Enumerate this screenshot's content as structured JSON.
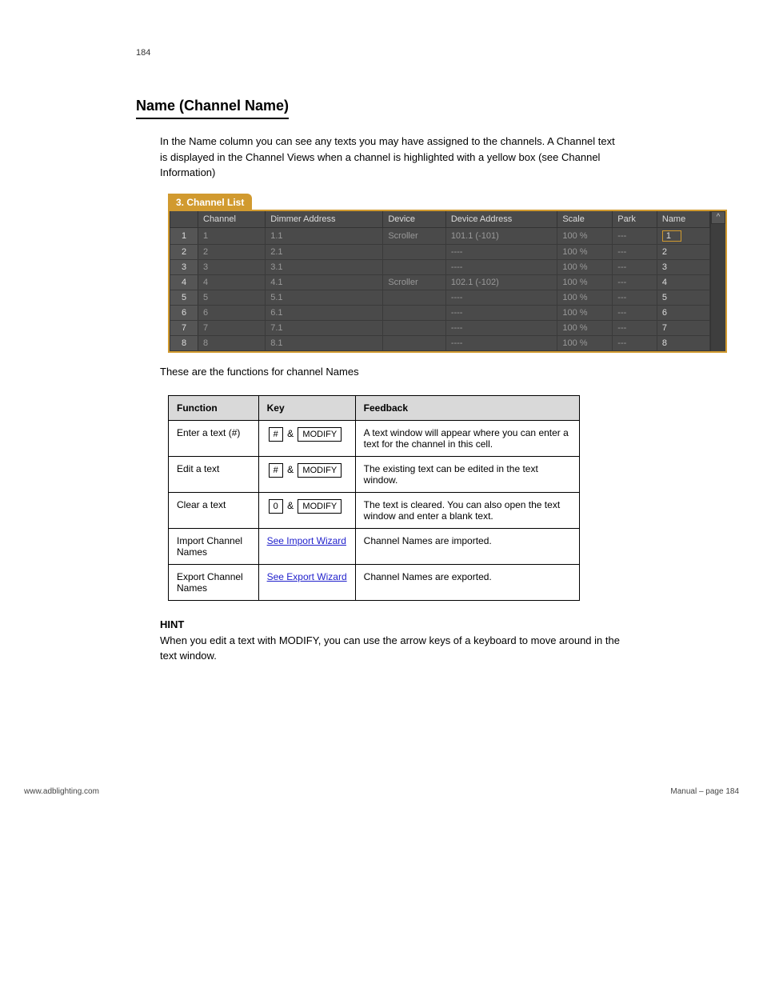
{
  "page_label": "184",
  "section_heading": "Name (Channel Name)",
  "intro_paragraphs": [
    "In the Name column you can see any texts you may have assigned to the channels.  A Channel text is displayed in the Channel Views when a channel is highlighted with a yellow box (see Channel Information)"
  ],
  "screenshot": {
    "tab_title": "3. Channel List",
    "headers": [
      "",
      "Channel",
      "Dimmer Address",
      "Device",
      "Device Address",
      "Scale",
      "Park",
      "Name"
    ],
    "rows": [
      {
        "n": "1",
        "ch": "1",
        "dim": "1.1",
        "dev": "Scroller",
        "da": "101.1 (-101)",
        "sc": "100 %",
        "pk": "---",
        "nm": "1",
        "sel": true
      },
      {
        "n": "2",
        "ch": "2",
        "dim": "2.1",
        "dev": "",
        "da": "----",
        "sc": "100 %",
        "pk": "---",
        "nm": "2",
        "sel": false
      },
      {
        "n": "3",
        "ch": "3",
        "dim": "3.1",
        "dev": "",
        "da": "----",
        "sc": "100 %",
        "pk": "---",
        "nm": "3",
        "sel": false
      },
      {
        "n": "4",
        "ch": "4",
        "dim": "4.1",
        "dev": "Scroller",
        "da": "102.1 (-102)",
        "sc": "100 %",
        "pk": "---",
        "nm": "4",
        "sel": false
      },
      {
        "n": "5",
        "ch": "5",
        "dim": "5.1",
        "dev": "",
        "da": "----",
        "sc": "100 %",
        "pk": "---",
        "nm": "5",
        "sel": false
      },
      {
        "n": "6",
        "ch": "6",
        "dim": "6.1",
        "dev": "",
        "da": "----",
        "sc": "100 %",
        "pk": "---",
        "nm": "6",
        "sel": false
      },
      {
        "n": "7",
        "ch": "7",
        "dim": "7.1",
        "dev": "",
        "da": "----",
        "sc": "100 %",
        "pk": "---",
        "nm": "7",
        "sel": false
      },
      {
        "n": "8",
        "ch": "8",
        "dim": "8.1",
        "dev": "",
        "da": "----",
        "sc": "100 %",
        "pk": "---",
        "nm": "8",
        "sel": false
      }
    ],
    "scroll_up": "^"
  },
  "functions_intro": "These are the functions for channel Names",
  "func_table": {
    "headers": [
      "Function",
      "Key",
      "Feedback"
    ],
    "rows": [
      {
        "func": "Enter a text (#)",
        "keys": [
          "#",
          "MODIFY"
        ],
        "fb": "A text window will appear where you can enter a text for the channel in this cell."
      },
      {
        "func": "Edit a text",
        "keys": [
          "#",
          "MODIFY"
        ],
        "fb": "The existing text can be edited in the text window."
      },
      {
        "func": "Clear a text",
        "keys": [
          "0",
          "MODIFY"
        ],
        "fb": "The text is cleared. You can also open the text window and enter a blank text."
      },
      {
        "func": "Import Channel Names",
        "link": "See Import Wizard",
        "fb": "Channel Names are imported."
      },
      {
        "func": "Export Channel Names",
        "link": "See Export Wizard",
        "fb": "Channel Names are exported."
      }
    ]
  },
  "hint_label": "HINT",
  "hint_text": "When you edit a text with MODIFY, you can use the arrow keys of a keyboard to move around in the text window.",
  "footer_left": "www.adblighting.com",
  "footer_right": "Manual – page 184"
}
